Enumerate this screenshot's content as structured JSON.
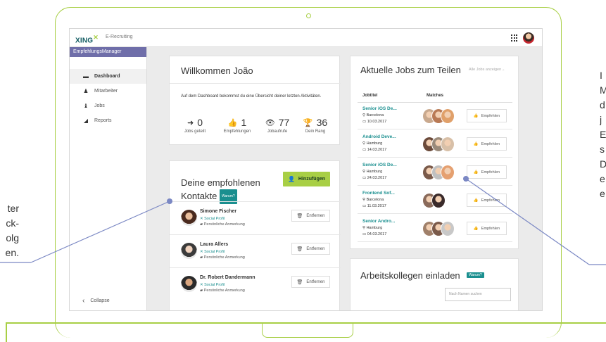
{
  "side_text": {
    "left_lines": [
      "ter",
      "ck-",
      "olg",
      "en."
    ],
    "right_lines": [
      "I",
      "M",
      "d",
      "j",
      "E",
      "s",
      "D",
      "e",
      "e"
    ]
  },
  "app": {
    "brand": "XING",
    "brand_sub": "E-Recruiting",
    "sidebar_header": "EmpfehlungsManager",
    "nav": [
      {
        "label": "Dashboard",
        "icon": "monitor-icon"
      },
      {
        "label": "Mitarbeiter",
        "icon": "person-icon"
      },
      {
        "label": "Jobs",
        "icon": "chess-pawn-icon"
      },
      {
        "label": "Reports",
        "icon": "chart-icon"
      }
    ],
    "collapse_label": "Collapse"
  },
  "welcome": {
    "title": "Willkommen João",
    "intro": "Auf dem Dashboard bekommst du eine Übersicht deiner letzten Aktivitäten.",
    "stats": [
      {
        "value": "0",
        "label": "Jobs geteilt"
      },
      {
        "value": "1",
        "label": "Empfehlungen"
      },
      {
        "value": "77",
        "label": "Jobaufrufe"
      },
      {
        "value": "36",
        "label": "Dein Rang"
      }
    ]
  },
  "contacts": {
    "title_line1": "Deine empfohlenen",
    "title_line2": "Kontakte",
    "why_badge": "Warum?",
    "add_label": "Hinzufügen",
    "remove_label": "Entfernen",
    "social_label": "Social Profil",
    "note_label": "Persönliche Anmerkung",
    "items": [
      {
        "name": "Simone Fischer"
      },
      {
        "name": "Laura Allers"
      },
      {
        "name": "Dr. Robert Dandermann"
      }
    ]
  },
  "jobs": {
    "title": "Aktuelle Jobs zum Teilen",
    "all_link": "Alle Jobs anzeigen→",
    "col_title": "Jobtitel",
    "col_matches": "Matches",
    "recommend_label": "Empfehlen",
    "items": [
      {
        "title": "Senior iOS De...",
        "city": "Barcelona",
        "date": "10.03.2017"
      },
      {
        "title": "Android Deve...",
        "city": "Hamburg",
        "date": "14.03.2017"
      },
      {
        "title": "Senior iOS De...",
        "city": "Hamburg",
        "date": "24.03.2017"
      },
      {
        "title": "Frontend Sof...",
        "city": "Barcelona",
        "date": "11.03.2017"
      },
      {
        "title": "Senior Andro...",
        "city": "Hamburg",
        "date": "04.03.2017"
      }
    ]
  },
  "invite": {
    "title": "Arbeitskollegen einladen",
    "why_badge": "Warum?",
    "search_placeholder": "Nach Namen suchen"
  },
  "colors": {
    "accent_green": "#a8cf45",
    "teal": "#1a8f8f",
    "sidebar_purple": "#6f6ea9",
    "callout_line": "#7b88c4"
  }
}
